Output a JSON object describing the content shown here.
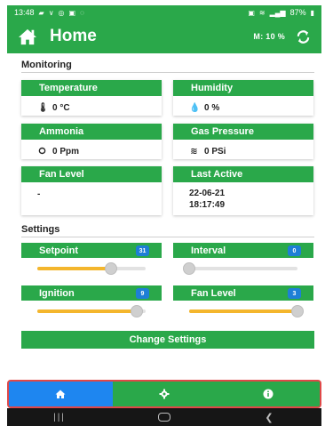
{
  "status_bar": {
    "time": "13:48",
    "left_icons": [
      "chat-icon",
      "vpn-icon",
      "instagram-icon",
      "app-icon",
      "whatsapp-icon"
    ],
    "right_icons": [
      "hotspot-icon",
      "nfc-icon",
      "signal-icon"
    ],
    "battery": "87%"
  },
  "header": {
    "title": "Home",
    "mode": "M: 10 %",
    "icons": {
      "home": "home-icon",
      "refresh": "refresh-icon"
    }
  },
  "monitoring": {
    "title": "Monitoring",
    "cards": [
      {
        "label": "Temperature",
        "icon": "thermometer-icon",
        "value": "0 °C"
      },
      {
        "label": "Humidity",
        "icon": "droplet-icon",
        "value": "0 %"
      },
      {
        "label": "Ammonia",
        "icon": "gas-ring-icon",
        "value": "0 Ppm"
      },
      {
        "label": "Gas Pressure",
        "icon": "wind-icon",
        "value": "0 PSi"
      },
      {
        "label": "Fan Level",
        "icon": "",
        "value": "-"
      },
      {
        "label": "Last Active",
        "icon": "",
        "date": "22-06-21",
        "time": "18:17:49"
      }
    ]
  },
  "settings": {
    "title": "Settings",
    "sliders": [
      {
        "label": "Setpoint",
        "badge": "31",
        "level": 0.68
      },
      {
        "label": "Interval",
        "badge": "0",
        "level": 0.0
      },
      {
        "label": "Ignition",
        "badge": "9",
        "level": 0.92
      },
      {
        "label": "Fan Level",
        "badge": "3",
        "level": 1.0
      }
    ],
    "change_button": "Change Settings"
  },
  "bottom_nav": {
    "items": [
      {
        "icon": "home-icon",
        "active": true
      },
      {
        "icon": "gear-icon",
        "active": false
      },
      {
        "icon": "info-icon",
        "active": false
      }
    ]
  },
  "colors": {
    "primary_green": "#2aa84a",
    "active_blue": "#1e86f0",
    "badge_blue": "#1e7fd6",
    "slider_yellow": "#f4b62d",
    "highlight_red": "#e04848"
  }
}
